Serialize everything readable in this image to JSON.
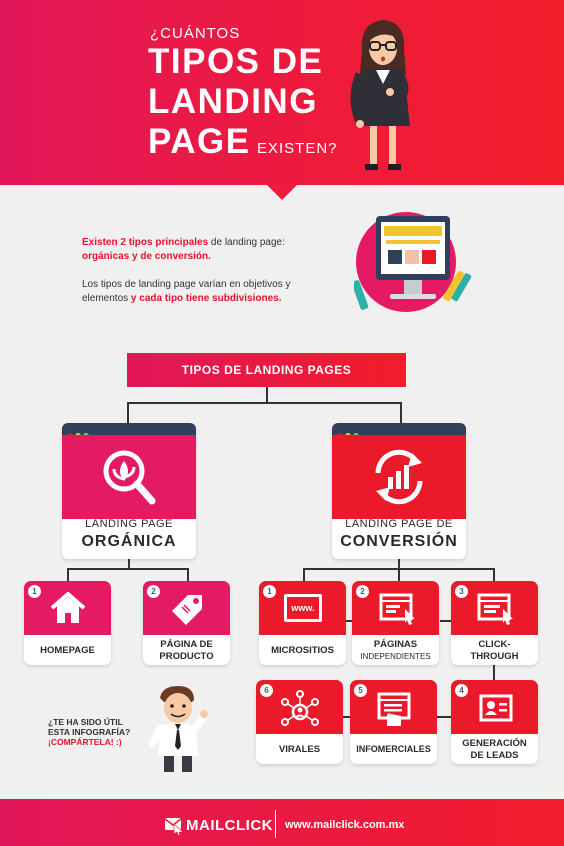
{
  "header": {
    "line1": "¿CUÁNTOS",
    "line2": "TIPOS DE",
    "line3": "LANDING",
    "line4": "PAGE",
    "line4b": "EXISTEN?"
  },
  "intro": {
    "p1_red": "Existen 2 tipos principales",
    "p1_rest": " de landing page:",
    "p1_red2": "orgánicas y de conversión.",
    "p2_a": "Los tipos de landing page varían en objetivos y",
    "p2_b": "elementos ",
    "p2_red": "y cada tipo tiene subdivisiones."
  },
  "tree": {
    "title": "TIPOS DE LANDING PAGES",
    "left": {
      "label": "LANDING PAGE",
      "label_big": "ORGÁNICA"
    },
    "right": {
      "label": "LANDING PAGE DE",
      "label_big": "CONVERSIÓN"
    }
  },
  "organic_items": [
    {
      "num": "1",
      "label": "HOMEPAGE"
    },
    {
      "num": "2",
      "label1": "PÁGINA DE",
      "label2": "PRODUCTO"
    }
  ],
  "conversion_items": [
    {
      "num": "1",
      "label": "MICROSITIOS"
    },
    {
      "num": "2",
      "label1": "PÁGINAS",
      "label2": "INDEPENDIENTES"
    },
    {
      "num": "3",
      "label1": "CLICK-",
      "label2": "THROUGH"
    },
    {
      "num": "4",
      "label1": "GENERACIÓN",
      "label2": "DE LEADS"
    },
    {
      "num": "5",
      "label": "INFOMERCIALES"
    },
    {
      "num": "6",
      "label": "VIRALES"
    }
  ],
  "www_text": "www.",
  "share": {
    "q1": "¿TE HA SIDO ÚTIL",
    "q2": "ESTA INFOGRAFÍA?",
    "cta": "¡COMPÁRTELA! :)"
  },
  "footer": {
    "brand": "MAILCLICK",
    "url": "www.mailclick.com.mx"
  },
  "colors": {
    "pink": "#e41b62",
    "red": "#ea1a2a",
    "navy": "#30405a"
  }
}
